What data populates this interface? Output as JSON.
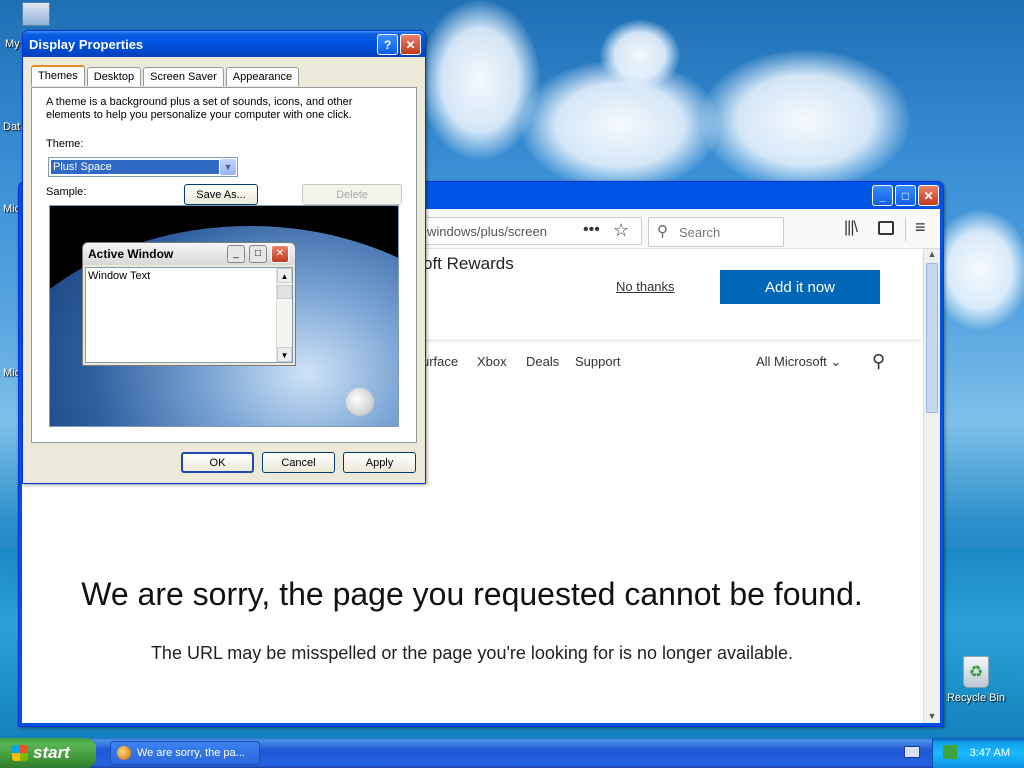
{
  "desktop": {
    "icons": [
      {
        "label": "My"
      },
      {
        "label": "Dat"
      },
      {
        "label": "Mic"
      },
      {
        "label": "Mic"
      }
    ],
    "recycle_bin": "Recycle Bin"
  },
  "browser": {
    "url": "windows/plus/screen",
    "search_placeholder": "Search",
    "rewards_title": "oft Rewards",
    "no_thanks": "No thanks",
    "add_it_now": "Add it now",
    "nav": [
      "urface",
      "Xbox",
      "Deals",
      "Support"
    ],
    "all_microsoft": "All Microsoft",
    "error_title": "We are sorry, the page you requested cannot be found.",
    "error_subtitle": "The URL may be misspelled or the page you're looking for is no longer available."
  },
  "display_properties": {
    "title": "Display Properties",
    "tabs": [
      "Themes",
      "Desktop",
      "Screen Saver",
      "Appearance"
    ],
    "description": "A theme is a background plus a set of sounds, icons, and other elements to help you personalize your computer with one click.",
    "theme_label": "Theme:",
    "theme_value": "Plus! Space",
    "save_as": "Save As...",
    "delete": "Delete",
    "sample_label": "Sample:",
    "sample_window_title": "Active Window",
    "sample_window_text": "Window Text",
    "ok": "OK",
    "cancel": "Cancel",
    "apply": "Apply"
  },
  "taskbar": {
    "start": "start",
    "task": "We are sorry, the pa...",
    "time": "3:47 AM"
  }
}
